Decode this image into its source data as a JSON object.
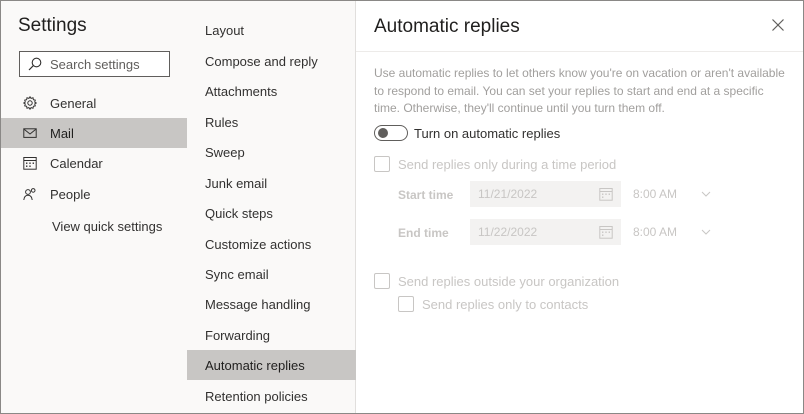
{
  "window": {
    "title": "Settings"
  },
  "search": {
    "placeholder": "Search settings",
    "value": ""
  },
  "nav": {
    "items": [
      {
        "label": "General",
        "icon": "gear-icon",
        "selected": false
      },
      {
        "label": "Mail",
        "icon": "mail-icon",
        "selected": true
      },
      {
        "label": "Calendar",
        "icon": "calendar-icon",
        "selected": false
      },
      {
        "label": "People",
        "icon": "people-icon",
        "selected": false
      }
    ],
    "quick_settings": "View quick settings"
  },
  "mail_sections": {
    "items": [
      "Layout",
      "Compose and reply",
      "Attachments",
      "Rules",
      "Sweep",
      "Junk email",
      "Quick steps",
      "Customize actions",
      "Sync email",
      "Message handling",
      "Forwarding",
      "Automatic replies",
      "Retention policies"
    ],
    "selected": "Automatic replies"
  },
  "panel": {
    "title": "Automatic replies",
    "close_icon": "close-icon",
    "description": "Use automatic replies to let others know you're on vacation or aren't available to respond to email. You can set your replies to start and end at a specific time. Otherwise, they'll continue until you turn them off.",
    "toggle": {
      "label": "Turn on automatic replies",
      "on": false
    },
    "time_period": {
      "label": "Send replies only during a time period",
      "checked": false,
      "disabled": true
    },
    "start": {
      "label": "Start time",
      "date": "11/21/2022",
      "time": "8:00 AM"
    },
    "end": {
      "label": "End time",
      "date": "11/22/2022",
      "time": "8:00 AM"
    },
    "outside_org": {
      "label": "Send replies outside your organization",
      "checked": false,
      "disabled": true
    },
    "contacts_only": {
      "label": "Send replies only to contacts",
      "checked": false,
      "disabled": true
    }
  },
  "colors": {
    "selected_bg": "#c8c6c4",
    "pane_bg": "#faf9f8",
    "disabled_text": "#c8c6c4",
    "text": "#323130"
  }
}
